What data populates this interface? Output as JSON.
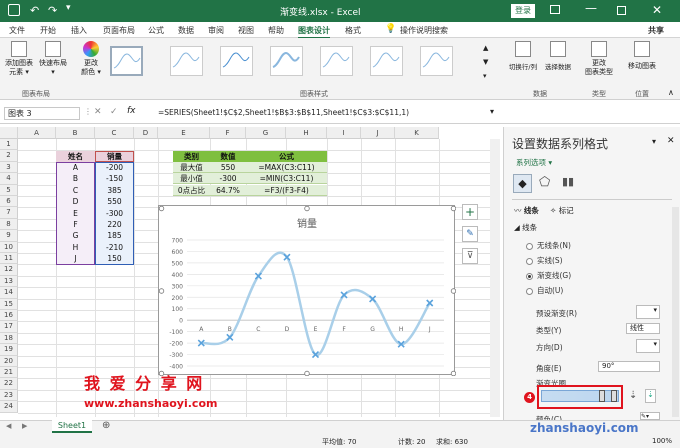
{
  "titlebar": {
    "file": "渐变线.xlsx",
    "sep": "-",
    "app": "Excel",
    "login": "登录",
    "share_icon": "user-icon"
  },
  "tabs": [
    "文件",
    "开始",
    "插入",
    "页面布局",
    "公式",
    "数据",
    "审阅",
    "视图",
    "帮助",
    "图表设计",
    "格式"
  ],
  "tell_me": "操作说明搜索",
  "share": "共享",
  "ribbon": {
    "add_element": "添加图表\n元素 ▾",
    "quick_layout": "快速布局\n▾",
    "change_colors": "更改\n颜色 ▾",
    "group_layouts": "图表布局",
    "group_styles": "图表样式",
    "switch": "切换行/列",
    "select_data": "选择数据",
    "group_data": "数据",
    "change_type": "更改\n图表类型",
    "group_type": "类型",
    "move": "移动图表",
    "group_location": "位置"
  },
  "namebox": "图表 3",
  "formula": "=SERIES(Sheet1!$C$2,Sheet1!$B$3:$B$11,Sheet1!$C$3:$C$11,1)",
  "columns": [
    "A",
    "B",
    "C",
    "D",
    "E",
    "F",
    "G",
    "H",
    "I",
    "J",
    "K"
  ],
  "rows": [
    "1",
    "2",
    "3",
    "4",
    "5",
    "6",
    "7",
    "8",
    "9",
    "10",
    "11",
    "12",
    "13",
    "14",
    "15",
    "16",
    "17",
    "18",
    "19",
    "20",
    "21",
    "22",
    "23",
    "24"
  ],
  "table1": {
    "h1": "姓名",
    "h2": "销量",
    "names": [
      "A",
      "B",
      "C",
      "D",
      "E",
      "F",
      "G",
      "H",
      "J"
    ],
    "vals": [
      "-200",
      "-150",
      "385",
      "550",
      "-300",
      "220",
      "185",
      "-210",
      "150"
    ]
  },
  "table2": {
    "headers": [
      "类别",
      "数值",
      "公式"
    ],
    "rows": [
      [
        "最大值",
        "550",
        "=MAX(C3:C11)"
      ],
      [
        "最小值",
        "-300",
        "=MIN(C3:C11)"
      ],
      [
        "0点占比",
        "64.7%",
        "=F3/(F3-F4)"
      ]
    ]
  },
  "chart_data": {
    "type": "line",
    "title": "销量",
    "categories": [
      "A",
      "B",
      "C",
      "D",
      "E",
      "F",
      "G",
      "H",
      "J"
    ],
    "series": [
      {
        "name": "销量",
        "values": [
          -200,
          -150,
          385,
          550,
          -300,
          220,
          185,
          -210,
          150
        ]
      }
    ],
    "ylim": [
      -400,
      700
    ],
    "yticks": [
      "700",
      "600",
      "500",
      "400",
      "300",
      "200",
      "100",
      "0",
      "-100",
      "-200",
      "-300",
      "-400"
    ],
    "smooth": true,
    "grid": true,
    "line_color": "#a9cfe9",
    "marker_color": "#5aa2dc"
  },
  "watermark": {
    "cn": "我 爱 分 享 网",
    "url": "www.zhanshaoyi.com",
    "corner": "zhanshaoyi.com"
  },
  "pane": {
    "title": "设置数据系列格式",
    "series_options": "系列选项 ▾",
    "tab_line": "线条",
    "tab_marker": "标记",
    "section": "线条",
    "radios": [
      "无线条(N)",
      "实线(S)",
      "渐变线(G)",
      "自动(U)"
    ],
    "selected": 2,
    "preset": "预设渐变(R)",
    "type_label": "类型(Y)",
    "type_value": "线性",
    "direction": "方向(D)",
    "angle_label": "角度(E)",
    "angle_value": "90°",
    "stops_label": "渐变光圈",
    "badge": "4",
    "color_label": "颜色(C)"
  },
  "sheet_tab": "Sheet1",
  "status": {
    "avg": "平均值: 70",
    "count": "计数: 20",
    "sum": "求和: 630",
    "zoom": "100%"
  }
}
